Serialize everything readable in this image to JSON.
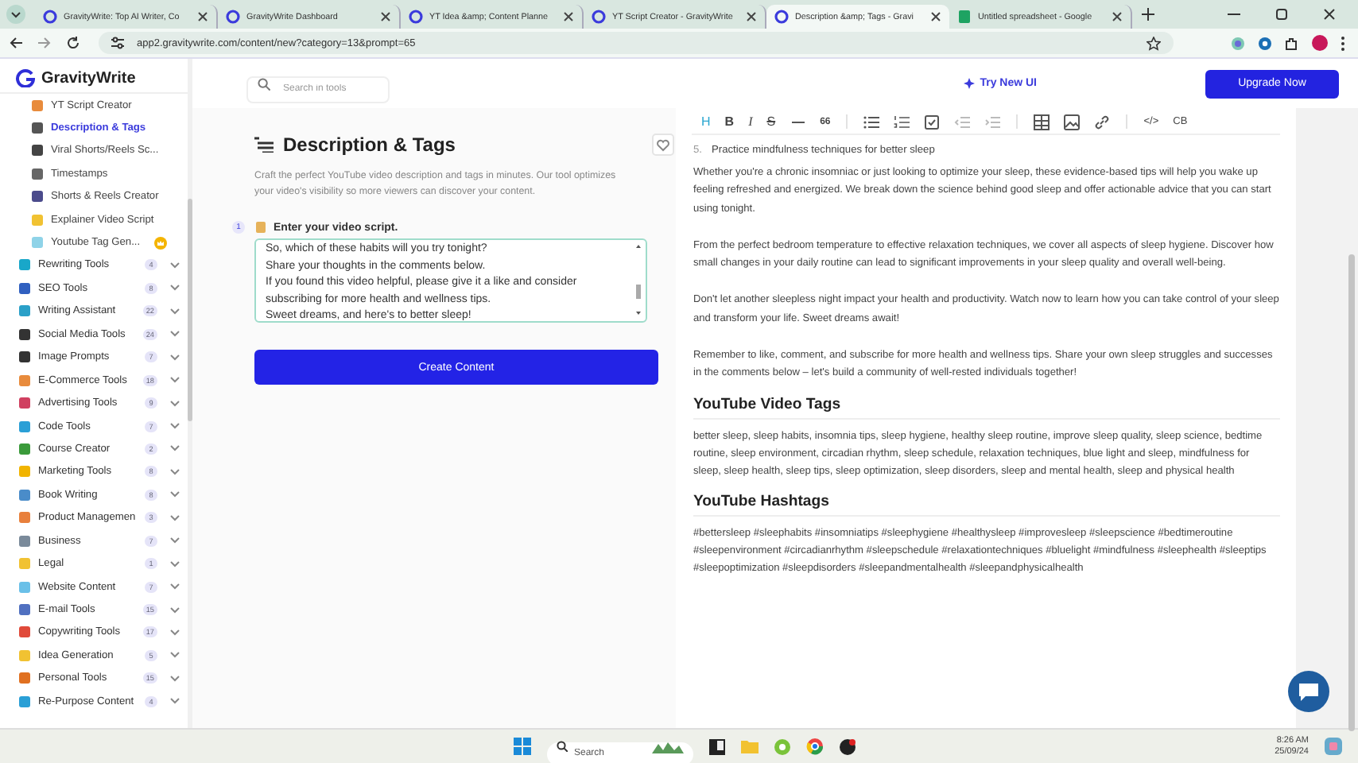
{
  "browser": {
    "tabs": [
      {
        "title": "GravityWrite: Top AI Writer, Co",
        "kind": "app",
        "selected": false
      },
      {
        "title": "GravityWrite Dashboard",
        "kind": "app",
        "selected": false
      },
      {
        "title": "YT Idea &amp; Content Planne",
        "kind": "app",
        "selected": false
      },
      {
        "title": "YT Script Creator - GravityWrite",
        "kind": "app",
        "selected": false
      },
      {
        "title": "Description &amp; Tags - Gravi",
        "kind": "app",
        "selected": true
      },
      {
        "title": "Untitled spreadsheet - Google",
        "kind": "sheet",
        "selected": false
      }
    ],
    "url": "app2.gravitywrite.com/content/new?category=13&prompt=65"
  },
  "sidebar": {
    "logo": "GravityWrite",
    "subitems": [
      {
        "label": "YT Script Creator",
        "selected": false,
        "crown": false
      },
      {
        "label": "Description & Tags",
        "selected": true,
        "crown": false
      },
      {
        "label": "Viral Shorts/Reels Sc...",
        "selected": false,
        "crown": false
      },
      {
        "label": "Timestamps",
        "selected": false,
        "crown": false
      },
      {
        "label": "Shorts & Reels Creator",
        "selected": false,
        "crown": false
      },
      {
        "label": "Explainer Video Script",
        "selected": false,
        "crown": false
      },
      {
        "label": "Youtube Tag Gen...",
        "selected": false,
        "crown": true
      }
    ],
    "categories": [
      {
        "label": "Rewriting Tools",
        "count": "4"
      },
      {
        "label": "SEO Tools",
        "count": "8"
      },
      {
        "label": "Writing Assistant",
        "count": "22"
      },
      {
        "label": "Social Media Tools",
        "count": "24"
      },
      {
        "label": "Image Prompts",
        "count": "7"
      },
      {
        "label": "E-Commerce Tools",
        "count": "18"
      },
      {
        "label": "Advertising Tools",
        "count": "9"
      },
      {
        "label": "Code Tools",
        "count": "7"
      },
      {
        "label": "Course Creator",
        "count": "2"
      },
      {
        "label": "Marketing Tools",
        "count": "8"
      },
      {
        "label": "Book Writing",
        "count": "8"
      },
      {
        "label": "Product Managemen",
        "count": "3"
      },
      {
        "label": "Business",
        "count": "7"
      },
      {
        "label": "Legal",
        "count": "1"
      },
      {
        "label": "Website Content",
        "count": "7"
      },
      {
        "label": "E-mail Tools",
        "count": "15"
      },
      {
        "label": "Copywriting Tools",
        "count": "17"
      },
      {
        "label": "Idea Generation",
        "count": "5"
      },
      {
        "label": "Personal Tools",
        "count": "15"
      },
      {
        "label": "Re-Purpose Content",
        "count": "4"
      }
    ]
  },
  "header": {
    "search_placeholder": "Search in tools",
    "try_new_ui": "Try New UI",
    "upgrade": "Upgrade Now"
  },
  "tool": {
    "title": "Description & Tags",
    "description": "Craft the perfect YouTube video description and tags in minutes. Our tool optimizes your video's visibility so more viewers can discover your content.",
    "step": "1",
    "field_label": "Enter your video script.",
    "script": "So, which of these habits will you try tonight?\nShare your thoughts in the comments below.\nIf you found this video helpful, please give it a like and consider subscribing for more health and wellness tips.\nSweet dreams, and here's to better sleep!",
    "button": "Create Content"
  },
  "editor": {
    "toolbar": [
      {
        "kind": "heading",
        "label": "H",
        "active": true
      },
      {
        "kind": "bold",
        "label": "B",
        "active": false
      },
      {
        "kind": "italic",
        "label": "I",
        "active": false
      },
      {
        "kind": "strike",
        "label": "S",
        "active": false
      },
      {
        "kind": "rule",
        "active": false
      },
      {
        "kind": "quote",
        "label": "66",
        "active": false
      },
      {
        "kind": "bullets",
        "active": false
      },
      {
        "kind": "numbers",
        "active": false
      },
      {
        "kind": "checklist",
        "active": false
      },
      {
        "kind": "outdent",
        "active": false
      },
      {
        "kind": "indent",
        "active": false
      },
      {
        "kind": "table",
        "active": false
      },
      {
        "kind": "image",
        "active": false
      },
      {
        "kind": "link",
        "active": false
      },
      {
        "kind": "code",
        "label": "</>",
        "active": false
      },
      {
        "kind": "codeblock",
        "label": "CB",
        "active": false
      }
    ],
    "content": [
      {
        "kind": "list_item",
        "number": "5.",
        "text": "Practice mindfulness techniques for better sleep"
      },
      {
        "kind": "paragraph",
        "text": "Whether you're a chronic insomniac or just looking to optimize your sleep, these evidence-based tips will help you wake up feeling refreshed and energized. We break down the science behind good sleep and offer actionable advice that you can start using tonight."
      },
      {
        "kind": "paragraph",
        "text": "From the perfect bedroom temperature to effective relaxation techniques, we cover all aspects of sleep hygiene. Discover how small changes in your daily routine can lead to significant improvements in your sleep quality and overall well-being."
      },
      {
        "kind": "paragraph",
        "text": "Don't let another sleepless night impact your health and productivity. Watch now to learn how you can take control of your sleep and transform your life. Sweet dreams await!"
      },
      {
        "kind": "paragraph",
        "text": "Remember to like, comment, and subscribe for more health and wellness tips. Share your own sleep struggles and successes in the comments below – let's build a community of well-rested individuals together!"
      },
      {
        "kind": "heading",
        "text": "YouTube Video Tags"
      },
      {
        "kind": "tags",
        "text": "better sleep, sleep habits, insomnia tips, sleep hygiene, healthy sleep routine, improve sleep quality, sleep science, bedtime routine, sleep environment, circadian rhythm, sleep schedule, relaxation techniques, blue light and sleep, mindfulness for sleep, sleep health, sleep tips, sleep optimization, sleep disorders, sleep and mental health, sleep and physical health"
      },
      {
        "kind": "heading",
        "text": "YouTube Hashtags"
      },
      {
        "kind": "tags",
        "text": "#bettersleep #sleephabits #insomniatips #sleephygiene #healthysleep #improvesleep #sleepscience #bedtimeroutine #sleepenvironment #circadianrhythm #sleepschedule #relaxationtechniques #bluelight #mindfulness #sleephealth #sleeptips #sleepoptimization #sleepdisorders #sleepandmentalhealth #sleepandphysicalhealth"
      }
    ]
  },
  "taskbar": {
    "search_placeholder": "Search",
    "time": "8:26 AM",
    "date": "25/09/24"
  }
}
